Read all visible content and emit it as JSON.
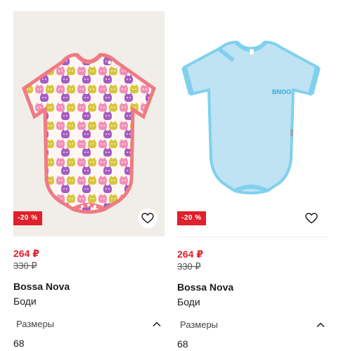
{
  "products": [
    {
      "discount": "-20 %",
      "price": "264 ₽",
      "old_price": "330 ₽",
      "brand": "Bossa Nova",
      "category": "Боди",
      "sizes_label": "Размеры",
      "sizes_value": "68"
    },
    {
      "discount": "-20 %",
      "price": "264 ₽",
      "old_price": "330 ₽",
      "brand": "Bossa Nova",
      "category": "Боди",
      "sizes_label": "Размеры",
      "sizes_value": "68",
      "garment_logo": "BNOO"
    }
  ],
  "colors": {
    "accent_red": "#e0202b",
    "bodysuit_blue": "#bfe3f2",
    "trim_blue": "#7fd0ef",
    "trim_coral": "#f07a83"
  }
}
